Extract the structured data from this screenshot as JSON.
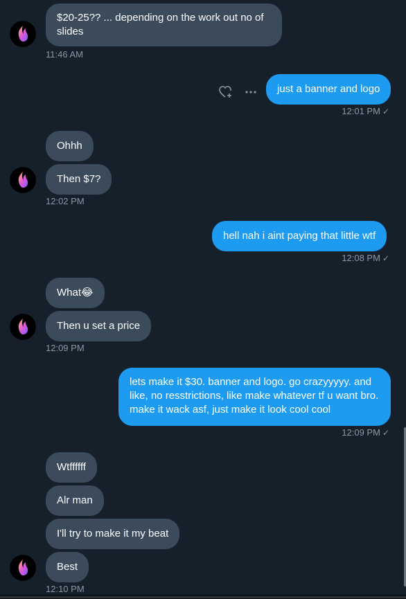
{
  "colors": {
    "background": "#15202b",
    "incoming": "#3b4b5c",
    "outgoing": "#1d9bf0",
    "meta": "#8b98a5"
  },
  "messages": {
    "m1": "$20-25?? ... depending on the work out no of slides",
    "t1": "11:46 AM",
    "m2": "just a banner and logo",
    "t2": "12:01 PM",
    "m3": "Ohhh",
    "m4": "Then $7?",
    "t3": "12:02 PM",
    "m5": "hell nah i aint paying that little wtf",
    "t4": "12:08 PM",
    "m6": "What😂",
    "m7": "Then u set a price",
    "t5": "12:09 PM",
    "m8": "lets make it $30. banner and logo. go crazyyyyy. and like, no resstrictions, like make whatever tf u want bro. make it wack asf, just make it look cool cool",
    "t6": "12:09 PM",
    "m9": "Wtffffff",
    "m10": "Alr man",
    "m11": "I'll try to make it my beat",
    "m12": "Best",
    "t7": "12:10 PM"
  },
  "icons": {
    "read": "check-icon",
    "react": "heart-plus-icon",
    "more": "more-icon",
    "avatar": "flame-logo"
  }
}
